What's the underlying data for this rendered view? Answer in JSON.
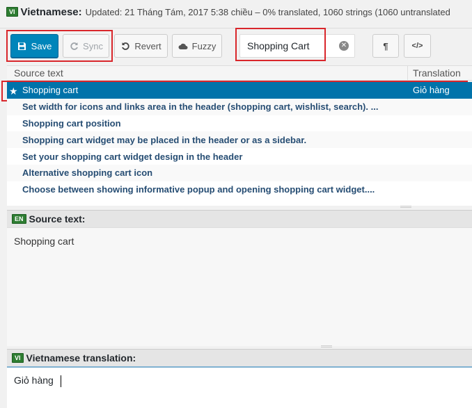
{
  "header": {
    "lang_code": "VI",
    "title": "Vietnamese:",
    "status": "Updated: 21 Tháng Tám, 2017 5:38 chiều – 0% translated, 1060 strings (1060 untranslated"
  },
  "toolbar": {
    "save_label": "Save",
    "sync_label": "Sync",
    "revert_label": "Revert",
    "fuzzy_label": "Fuzzy",
    "search_value": "Shopping Cart",
    "pilcrow_label": "¶",
    "code_label": "</>"
  },
  "list": {
    "col_source": "Source text",
    "col_translation": "Translation",
    "rows": [
      {
        "source": "Shopping cart",
        "translation": "Giỏ hàng"
      },
      {
        "source": "Set width for icons and links area in the header (shopping cart, wishlist, search). ...",
        "translation": ""
      },
      {
        "source": "Shopping cart position",
        "translation": ""
      },
      {
        "source": "Shopping cart widget may be placed in the header or as a sidebar.",
        "translation": ""
      },
      {
        "source": "Set your shopping cart widget design in the header",
        "translation": ""
      },
      {
        "source": "Alternative shopping cart icon",
        "translation": ""
      },
      {
        "source": "Choose between showing informative popup and opening shopping cart widget....",
        "translation": ""
      }
    ]
  },
  "source_panel": {
    "lang_code": "EN",
    "title": "Source text:",
    "text": "Shopping cart"
  },
  "translation_panel": {
    "lang_code": "VI",
    "title": "Vietnamese translation:",
    "text": "Giỏ hàng"
  },
  "colors": {
    "accent": "#0085ba",
    "selected_row": "#0073aa",
    "highlight": "#d9262b",
    "lang_badge": "#2e7d32"
  }
}
